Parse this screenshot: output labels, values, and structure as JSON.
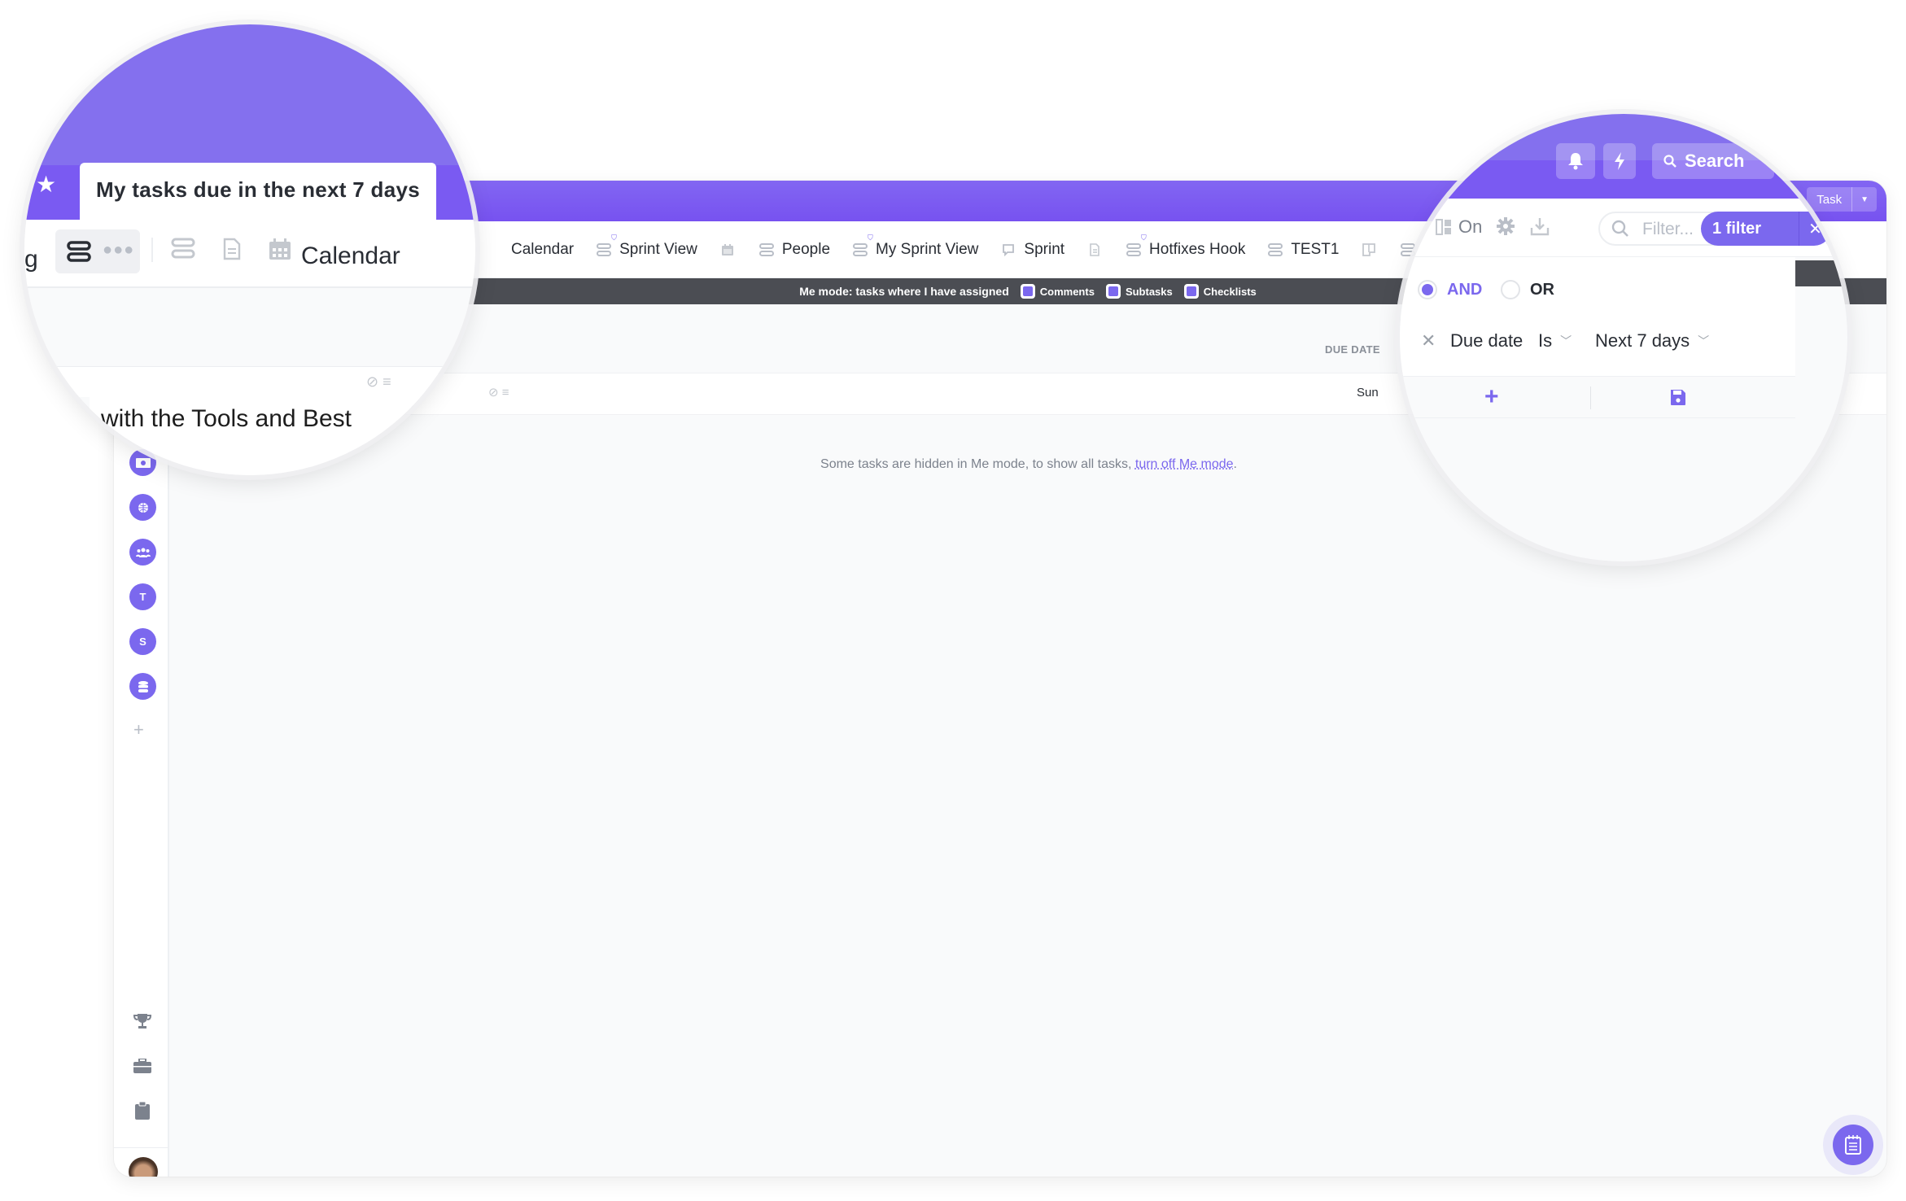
{
  "header": {
    "new_task_label": "Task",
    "notifications_icon": "bell-icon",
    "quick_action_icon": "lightning-icon",
    "search_label": "Search"
  },
  "views": {
    "active_view_title": "My tasks due in the next 7 days",
    "partial_left_label": "g",
    "items": [
      {
        "label": "Calendar",
        "icon": "calendar-icon"
      },
      {
        "label": "Sprint View",
        "icon": "list-icon",
        "protected": true
      },
      {
        "label": "",
        "icon": "calendar-icon"
      },
      {
        "label": "People",
        "icon": "list-icon"
      },
      {
        "label": "My Sprint View",
        "icon": "list-icon",
        "protected": true
      },
      {
        "label": "Sprint",
        "icon": "chat-icon"
      },
      {
        "label": "",
        "icon": "doc-icon"
      },
      {
        "label": "Hotfixes Hook",
        "icon": "list-icon",
        "protected": true
      },
      {
        "label": "TEST1",
        "icon": "list-icon"
      },
      {
        "label": "",
        "icon": "board-icon"
      },
      {
        "label": "",
        "icon": "list-icon"
      }
    ],
    "add_view_label": "+"
  },
  "toolbar": {
    "me_mode_toggle_label": "On",
    "filter_placeholder": "Filter...",
    "filter_badge": "1 filter"
  },
  "me_mode_bar": {
    "text": "Me mode: tasks where I have assigned",
    "options": [
      {
        "label": "Comments",
        "checked": true
      },
      {
        "label": "Subtasks",
        "checked": true
      },
      {
        "label": "Checklists",
        "checked": true
      }
    ]
  },
  "filter_panel": {
    "logic_options": [
      {
        "label": "AND",
        "selected": true
      },
      {
        "label": "OR",
        "selected": false
      }
    ],
    "conditions": [
      {
        "field": "Due date",
        "operator": "Is",
        "value": "Next 7 days"
      }
    ]
  },
  "table": {
    "columns": [
      "DUE DATE"
    ],
    "rows": [
      {
        "title_fragment": "with the Tools and Best",
        "due_date": "Sun"
      }
    ]
  },
  "hidden_message": {
    "text": "Some tasks are hidden in Me mode, to show all tasks, ",
    "link": "turn off Me mode",
    "suffix": "."
  },
  "sidebar": {
    "spaces": [
      {
        "icon": "money-icon",
        "label": ""
      },
      {
        "icon": "globe-icon",
        "label": ""
      },
      {
        "icon": "team-icon",
        "label": ""
      },
      {
        "icon": "letter-avatar",
        "label": "T"
      },
      {
        "icon": "letter-avatar",
        "label": "S"
      },
      {
        "icon": "database-icon",
        "label": ""
      }
    ],
    "add_label": "+",
    "bottom_icons": [
      "trophy-icon",
      "briefcase-icon",
      "clipboard-icon"
    ]
  },
  "colors": {
    "brand": "#7b68ee",
    "header": "#7b5cf0",
    "me_mode_bar": "#4b4d53"
  }
}
